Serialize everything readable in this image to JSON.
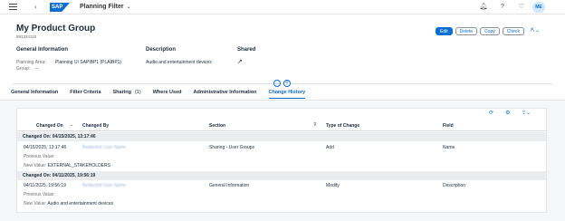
{
  "shell": {
    "app_title": "Planning Filter",
    "avatar_initials": "ME",
    "logo_text": "SAP"
  },
  "header": {
    "title": "My Product Group",
    "subtitle": "891324110",
    "actions": {
      "edit": "Edit",
      "delete": "Delete",
      "copy": "Copy",
      "check": "Check"
    },
    "general": {
      "heading": "General Information",
      "planning_area_label": "Planning Area:",
      "planning_area_value": "Planning UI SAPIBP1 (PLAIBP1)",
      "group_label": "Group:",
      "group_value": "--"
    },
    "description": {
      "heading": "Description",
      "value": "Audio and entertainment devices"
    },
    "shared": {
      "heading": "Shared"
    }
  },
  "tabs": [
    {
      "label": "General Information"
    },
    {
      "label": "Filter Criteria"
    },
    {
      "label": "Sharing",
      "count": "(1)"
    },
    {
      "label": "Where Used"
    },
    {
      "label": "Administrative Information"
    },
    {
      "label": "Change History"
    }
  ],
  "table": {
    "columns": {
      "changed_on": "Changed On",
      "changed_by": "Changed By",
      "section": "Section",
      "type": "Type of Change",
      "field": "Field"
    },
    "groups": [
      {
        "header": "Changed On: 04/15/2025, 13:17:46",
        "date": "04/15/2025, 13:17:46",
        "user": "Redacted User Name",
        "section": "Sharing - User Groups",
        "type": "Add",
        "field": "Name",
        "prev_label": "Previous Value:",
        "prev_value": "",
        "new_label": "New Value:",
        "new_value": "EXTERNAL_STAKEHOLDERS"
      },
      {
        "header": "Changed On: 04/11/2025, 19:56:19",
        "date": "04/11/2025, 19:56:19",
        "user": "Redacted User Name",
        "section": "General Information",
        "type": "Modify",
        "field": "Description",
        "prev_label": "Previous Value:",
        "prev_value": "",
        "new_label": "New Value:",
        "new_value": "Audio and entertainment devices"
      }
    ]
  },
  "colors": {
    "accent": "#0a6ed1",
    "group_row_bg": "#eaecee",
    "content_bg": "#f5f6f7"
  }
}
